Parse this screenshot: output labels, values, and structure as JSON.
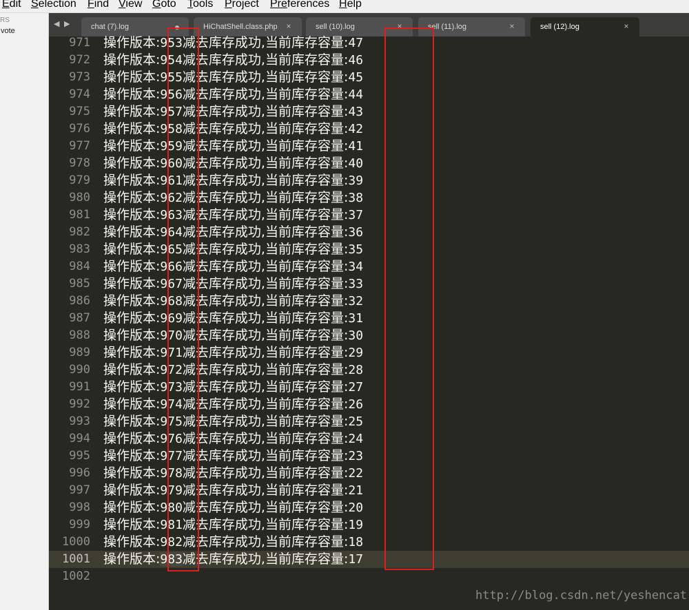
{
  "menu": [
    {
      "ul": "E",
      "rest": "dit"
    },
    {
      "ul": "S",
      "rest": "election"
    },
    {
      "ul": "F",
      "rest": "ind"
    },
    {
      "ul": "V",
      "rest": "iew"
    },
    {
      "ul": "G",
      "rest": "oto"
    },
    {
      "ul": "T",
      "rest": "ools"
    },
    {
      "ul": "P",
      "rest": "roject"
    },
    {
      "ul": "Pre",
      "rest": "ferences"
    },
    {
      "ul": "H",
      "rest": "elp"
    }
  ],
  "sidebar": {
    "header": "RS",
    "file": "vote"
  },
  "tabs": [
    {
      "label": "chat (7).log",
      "dirty": true,
      "active": false
    },
    {
      "label": "HiChatShell.class.php",
      "dirty": false,
      "active": false
    },
    {
      "label": "sell (10).log",
      "dirty": false,
      "active": false
    },
    {
      "label": "sell (11).log",
      "dirty": false,
      "active": false
    },
    {
      "label": "sell (12).log",
      "dirty": false,
      "active": true
    }
  ],
  "nav_arrows": {
    "left": "◀",
    "right": "▶"
  },
  "close_glyph": "×",
  "editor": {
    "prefix": "操作版本:",
    "middle": "减去库存成功,当前库存容量:",
    "first_line_number": 971,
    "current_line": 1001,
    "empty_last_line": 1002,
    "versions": [
      953,
      954,
      955,
      956,
      957,
      958,
      959,
      960,
      961,
      962,
      963,
      964,
      965,
      966,
      967,
      968,
      969,
      970,
      971,
      972,
      973,
      974,
      975,
      976,
      977,
      978,
      979,
      980,
      981,
      982,
      983
    ],
    "quantities": [
      47,
      46,
      45,
      44,
      43,
      42,
      41,
      40,
      39,
      38,
      37,
      36,
      35,
      34,
      33,
      32,
      31,
      30,
      29,
      28,
      27,
      26,
      25,
      24,
      23,
      22,
      21,
      20,
      19,
      18,
      17
    ]
  },
  "colors": {
    "editor_bg": "#272822",
    "highlight_box": "#e01e1e"
  },
  "watermark": "http://blog.csdn.net/yeshencat"
}
